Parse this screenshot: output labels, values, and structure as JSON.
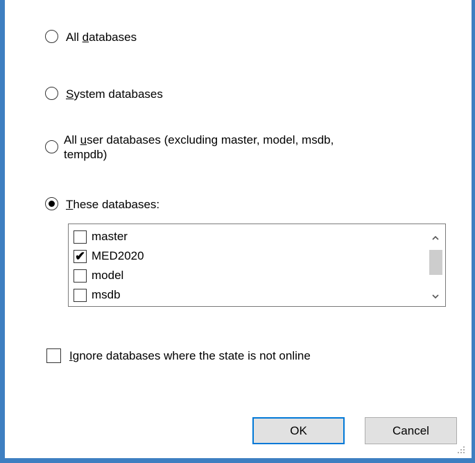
{
  "options": {
    "all": {
      "pre": "All ",
      "key": "d",
      "post": "atabases"
    },
    "system": {
      "pre": "",
      "key": "S",
      "post": "ystem databases"
    },
    "user_line1": {
      "pre": "All ",
      "key": "u",
      "post": "ser databases  (excluding master, model, msdb,"
    },
    "user_line2": "tempdb)",
    "these": {
      "pre": "",
      "key": "T",
      "post": "hese databases:"
    }
  },
  "databases": [
    {
      "name": "master",
      "mark": ""
    },
    {
      "name": "MED2020",
      "mark": "✔"
    },
    {
      "name": "model",
      "mark": ""
    },
    {
      "name": "msdb",
      "mark": ""
    }
  ],
  "ignore": {
    "pre": "",
    "key": "I",
    "post": "gnore databases where the state is not online"
  },
  "buttons": {
    "ok": "OK",
    "cancel": "Cancel"
  },
  "icons": {
    "scroll_up": "chevron-up-icon",
    "scroll_down": "chevron-down-icon",
    "checkmark": "checkmark-icon"
  },
  "colors": {
    "frame": "#3e7fc1",
    "button_face": "#e1e1e1",
    "default_border": "#0078d7"
  }
}
